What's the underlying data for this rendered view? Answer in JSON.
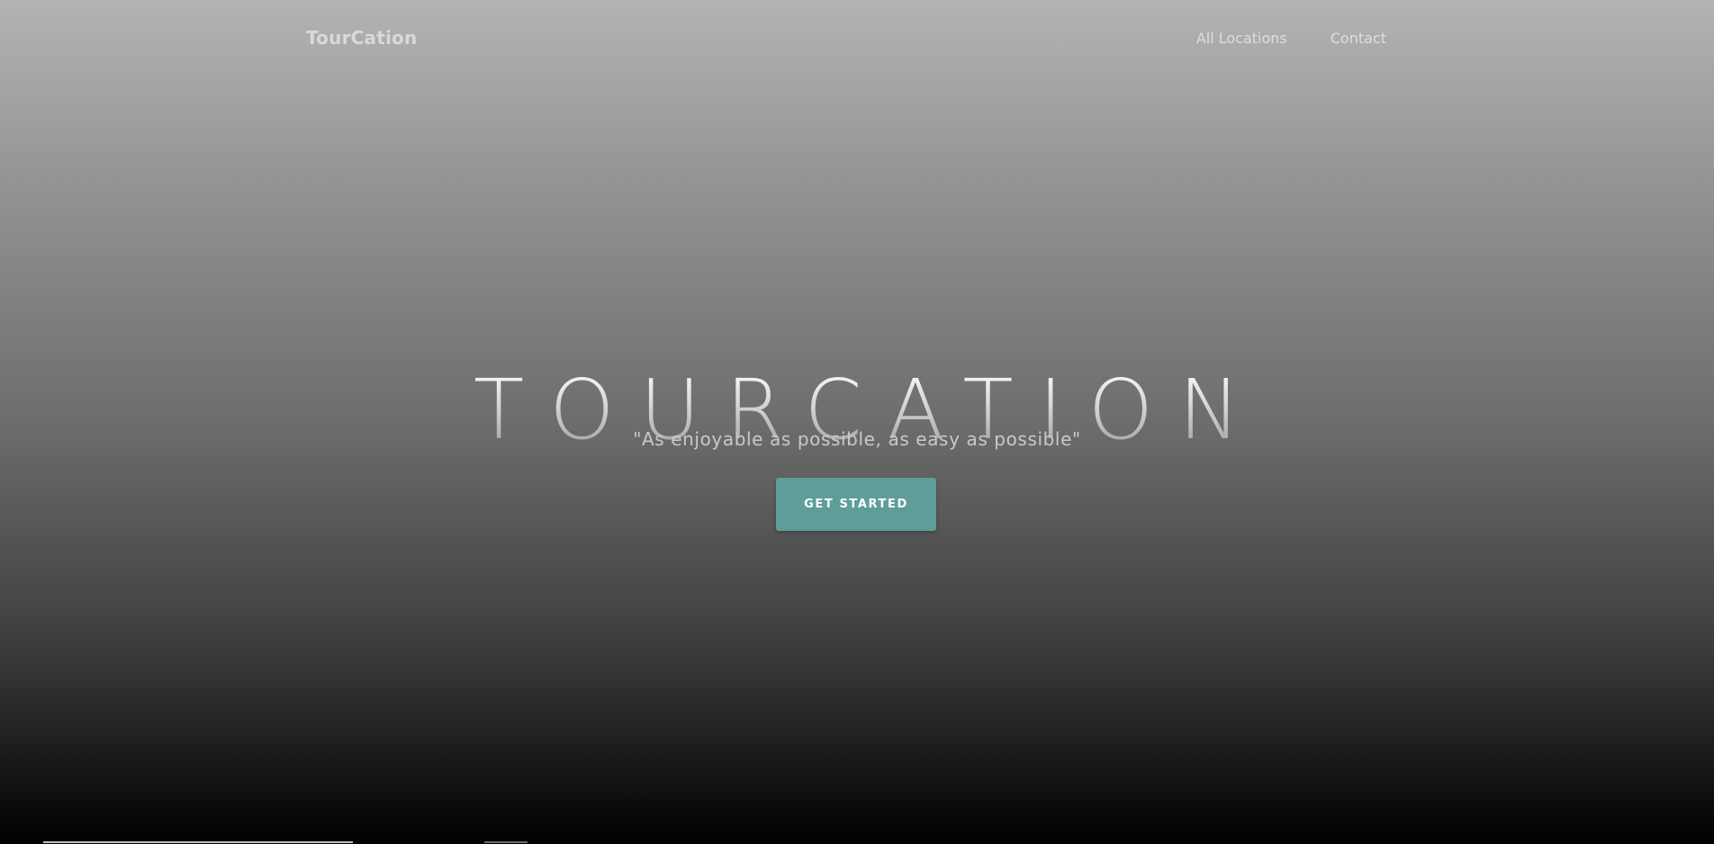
{
  "navbar": {
    "brand": "TourCation",
    "links": [
      "All Locations",
      "Contact"
    ]
  },
  "hero": {
    "title": "TOURCATION",
    "tagline": "\"As enjoyable as possible, as easy as possible\"",
    "cta_label": "GET STARTED"
  },
  "colors": {
    "cta_background": "#5f9e98",
    "gradient_top": "#b3b3b3",
    "gradient_bottom": "#000000"
  }
}
